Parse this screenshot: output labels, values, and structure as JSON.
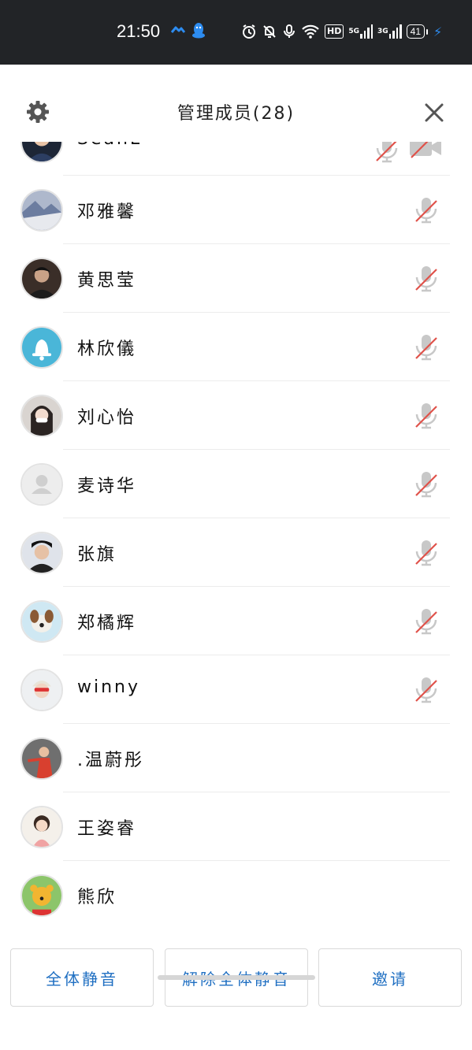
{
  "status_bar": {
    "time": "21:50",
    "net_5g": "5G",
    "net_3g": "3G",
    "hd": "HD",
    "battery": "41"
  },
  "header": {
    "title": "管理成员(28)"
  },
  "members": [
    {
      "name": "SeanL",
      "mic_muted": true,
      "camera_off": true
    },
    {
      "name": "邓雅馨",
      "mic_muted": true
    },
    {
      "name": "黄思莹",
      "mic_muted": true
    },
    {
      "name": "林欣儀",
      "mic_muted": true
    },
    {
      "name": "刘心怡",
      "mic_muted": true
    },
    {
      "name": "麦诗华",
      "mic_muted": true
    },
    {
      "name": "张旗",
      "mic_muted": true
    },
    {
      "name": "郑橘辉",
      "mic_muted": true
    },
    {
      "name": "winny",
      "mic_muted": true
    },
    {
      "name": ".温蔚彤",
      "mic_muted": false
    },
    {
      "name": "王姿睿",
      "mic_muted": false
    },
    {
      "name": "熊欣",
      "mic_muted": false
    }
  ],
  "footer": {
    "mute_all_label": "全体静音",
    "unmute_all_label": "解除全体静音",
    "invite_label": "邀请"
  },
  "colors": {
    "accent": "#1f6fc2",
    "status_bar_bg": "#222427",
    "muted_slash": "#e0524a"
  }
}
